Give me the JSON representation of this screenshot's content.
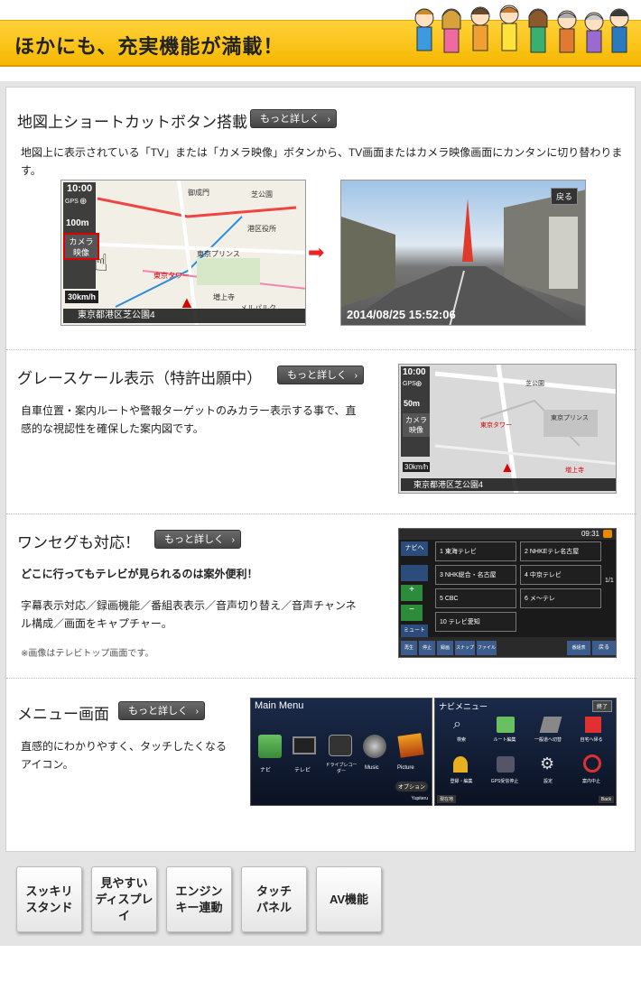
{
  "banner": {
    "title": "ほかにも、充実機能が満載！"
  },
  "sections": [
    {
      "title": "地図上ショートカットボタン搭載",
      "more": "もっと詳しく",
      "desc": "地図上に表示されている「TV」または「カメラ映像」ボタンから、TV画面またはカメラ映像画面にカンタンに切り替わります。",
      "map": {
        "time": "10:00",
        "gps": "GPS",
        "scale": "100m",
        "camera_button": "カメラ\n映像",
        "speed": "30km/h",
        "address": "東京都港区芝公園4",
        "labels": [
          "御成門",
          "芝公園",
          "東京プリンス",
          "港区役所",
          "東京タワー",
          "増上寺",
          "メルパルク"
        ]
      },
      "camera": {
        "timestamp": "2014/08/25 15:52:06",
        "back_button": "戻る"
      }
    },
    {
      "title": "グレースケール表示（特許出願中）",
      "more": "もっと詳しく",
      "desc": "自車位置・案内ルートや警報ターゲットのみカラー表示する事で、直感的な視認性を確保した案内図です。",
      "map": {
        "time": "10:00",
        "gps": "GPS",
        "scale": "50m",
        "camera_button": "カメラ\n映像",
        "speed": "30km/h",
        "address": "東京都港区芝公園4",
        "labels": [
          "芝公園",
          "東京プリンス",
          "東京タワー",
          "増上寺"
        ]
      }
    },
    {
      "title": "ワンセグも対応！",
      "more": "もっと詳しく",
      "subheading": "どこに行ってもテレビが見られるのは案外便利！",
      "desc": "字幕表示対応／録画機能／番組表表示／音声切り替え／音声チャンネル構成／画面をキャプチャー。",
      "note": "※画像はテレビトップ画面です。",
      "tv": {
        "time": "09:31",
        "channels": [
          "1 東海テレビ",
          "2 NHKEテレ名古屋",
          "3 NHK総合・名古屋",
          "4 中京テレビ",
          "5 CBC",
          "6 メ～テレ",
          "10 テレビ愛知"
        ],
        "left": [
          "ナビへ",
          "ミュート"
        ],
        "bottom": [
          "再生",
          "停止",
          "録画",
          "スナップ",
          "ファイル",
          "番組表",
          "戻る"
        ],
        "page": "1/1"
      }
    },
    {
      "title": "メニュー画面",
      "more": "もっと詳しく",
      "desc": "直感的にわかりやすく、タッチしたくなるアイコン。",
      "main_menu": {
        "title": "Main Menu",
        "items": [
          "ナビ",
          "テレビ",
          "ドライブレコーダー",
          "Music",
          "Picture"
        ],
        "option": "オプション",
        "brand": "Yupiteru"
      },
      "navi_menu": {
        "title": "ナビメニュー",
        "end": "終了",
        "items": [
          "検索",
          "ルート編集",
          "一般道へ切替",
          "自宅へ帰る",
          "登録・編集",
          "GPS受信停止",
          "設定",
          "案内中止"
        ],
        "back_left": "現在地",
        "back_right": "Back"
      }
    }
  ],
  "tabs": [
    "スッキリ\nスタンド",
    "見やすい\nディスプレイ",
    "エンジン\nキー連動",
    "タッチ\nパネル",
    "AV機能"
  ]
}
